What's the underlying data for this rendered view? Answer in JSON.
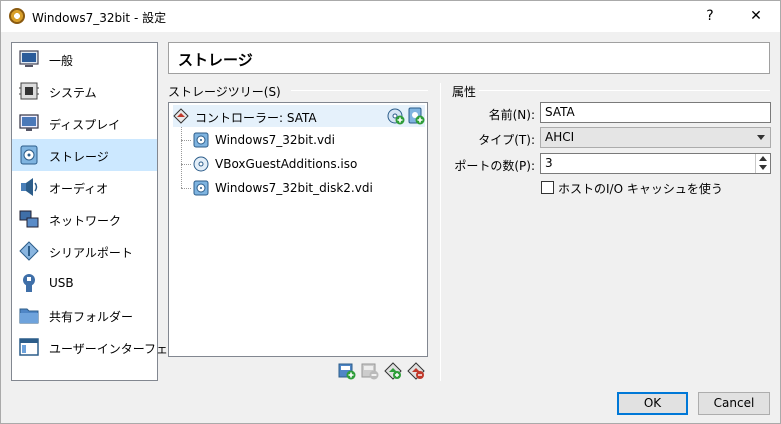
{
  "window": {
    "title": "Windows7_32bit - 設定",
    "help_label": "?",
    "close_label": "✕"
  },
  "sidebar": {
    "items": [
      {
        "label": "一般",
        "icon": "general-icon"
      },
      {
        "label": "システム",
        "icon": "system-icon"
      },
      {
        "label": "ディスプレイ",
        "icon": "display-icon"
      },
      {
        "label": "ストレージ",
        "icon": "storage-icon",
        "selected": true
      },
      {
        "label": "オーディオ",
        "icon": "audio-icon"
      },
      {
        "label": "ネットワーク",
        "icon": "network-icon"
      },
      {
        "label": "シリアルポート",
        "icon": "serial-port-icon"
      },
      {
        "label": "USB",
        "icon": "usb-icon"
      },
      {
        "label": "共有フォルダー",
        "icon": "shared-folder-icon"
      },
      {
        "label": "ユーザーインターフェース",
        "icon": "user-interface-icon"
      }
    ]
  },
  "page": {
    "title": "ストレージ"
  },
  "storage_tree": {
    "label": "ストレージツリー(S)",
    "controller": {
      "label": "コントローラー: SATA"
    },
    "devices": [
      {
        "label": "Windows7_32bit.vdi",
        "type": "hard-disk"
      },
      {
        "label": "VBoxGuestAdditions.iso",
        "type": "optical-disk"
      },
      {
        "label": "Windows7_32bit_disk2.vdi",
        "type": "hard-disk"
      }
    ]
  },
  "attributes": {
    "section_label": "属性",
    "name_label": "名前(N):",
    "name_value": "SATA",
    "type_label": "タイプ(T):",
    "type_value": "AHCI",
    "ports_label": "ポートの数(P):",
    "ports_value": "3",
    "host_cache_label": "ホストのI/O キャッシュを使う",
    "host_cache_checked": false
  },
  "buttons": {
    "ok": "OK",
    "cancel": "Cancel"
  },
  "colors": {
    "selection": "#cce8ff",
    "accent": "#0078d7",
    "add_green": "#2f9e3a"
  }
}
